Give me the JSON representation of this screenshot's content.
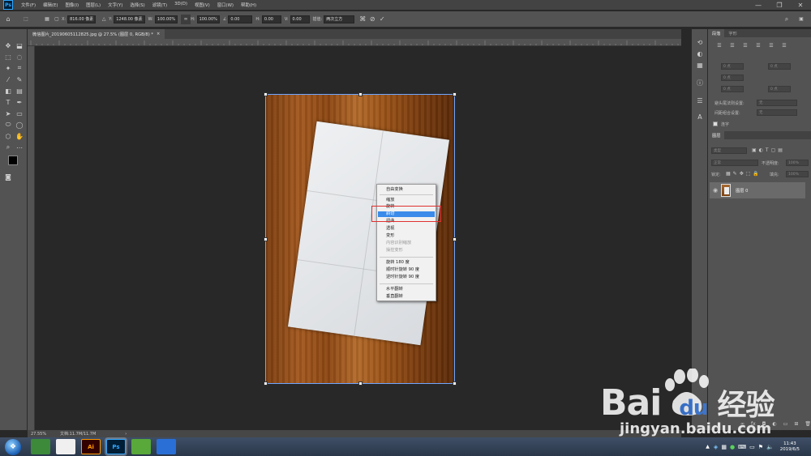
{
  "menubar": {
    "app_logo": "Ps",
    "items": [
      "文件(F)",
      "编辑(E)",
      "图像(I)",
      "图层(L)",
      "文字(Y)",
      "选择(S)",
      "滤镜(T)",
      "3D(D)",
      "视图(V)",
      "窗口(W)",
      "帮助(H)"
    ],
    "window_controls": [
      "—",
      "❐",
      "✕"
    ]
  },
  "options": {
    "x_label": "X:",
    "x_value": "816.00 像素",
    "y_label": "Y:",
    "y_value": "1248.00 像素",
    "w_label": "W:",
    "w_value": "100.00%",
    "h_label": "H:",
    "h_value": "100.00%",
    "angle_value": "0.00",
    "hskew_label": "H:",
    "hskew_value": "0.00",
    "vskew_label": "V:",
    "vskew_value": "0.00",
    "interp_label": "插值:",
    "interp_value": "两次立方"
  },
  "document": {
    "tab_title": "微信图片_20190605112825.jpg @ 27.5% (图层 0, RGB/8) *",
    "tab_close": "×"
  },
  "context_menu": {
    "items": [
      {
        "label": "自由变换",
        "disabled": false,
        "selected": false
      },
      {
        "label": "缩放",
        "disabled": false,
        "selected": false
      },
      {
        "label": "旋转",
        "disabled": false,
        "selected": false
      },
      {
        "label": "斜切",
        "disabled": false,
        "selected": true
      },
      {
        "label": "扭曲",
        "disabled": false,
        "selected": false
      },
      {
        "label": "透视",
        "disabled": false,
        "selected": false
      },
      {
        "label": "变形",
        "disabled": false,
        "selected": false
      },
      {
        "label": "内容识别缩放",
        "disabled": true,
        "selected": false
      },
      {
        "label": "操控变形",
        "disabled": true,
        "selected": false
      },
      {
        "label": "旋转 180 度",
        "disabled": false,
        "selected": false
      },
      {
        "label": "顺时针旋转 90 度",
        "disabled": false,
        "selected": false
      },
      {
        "label": "逆时针旋转 90 度",
        "disabled": false,
        "selected": false
      },
      {
        "label": "水平翻转",
        "disabled": false,
        "selected": false
      },
      {
        "label": "垂直翻转",
        "disabled": false,
        "selected": false
      }
    ]
  },
  "status": {
    "zoom": "27.55%",
    "doc_info": "文档:11.7M/11.7M",
    "arrow": "›"
  },
  "panels": {
    "tabs": [
      "段落",
      "字形"
    ],
    "hyphenate_label": "避头尾法则设置:",
    "hyphenate_value": "无",
    "spacing_label": "间距组合设置:",
    "spacing_value": "无",
    "connect_label": "连字",
    "field_value": "0 点",
    "layers_tab": "图层",
    "filter_kind": "类型",
    "blend_mode": "正常",
    "opacity_label": "不透明度:",
    "opacity_value": "100%",
    "lock_label": "锁定:",
    "fill_label": "填充:",
    "fill_value": "100%",
    "layer_name": "图层 0"
  },
  "taskbar": {
    "apps": [
      "",
      "",
      "Ai",
      "Ps",
      "",
      ""
    ],
    "clock_time": "11:43",
    "clock_date": "2019/6/5"
  },
  "watermark": {
    "brand": "Bai",
    "paw": "du",
    "cn": "经验",
    "url": "jingyan.baidu.com"
  },
  "colors": {
    "accent": "#3a8bea",
    "highlight": "#e03030",
    "ps_bg": "#282828"
  }
}
